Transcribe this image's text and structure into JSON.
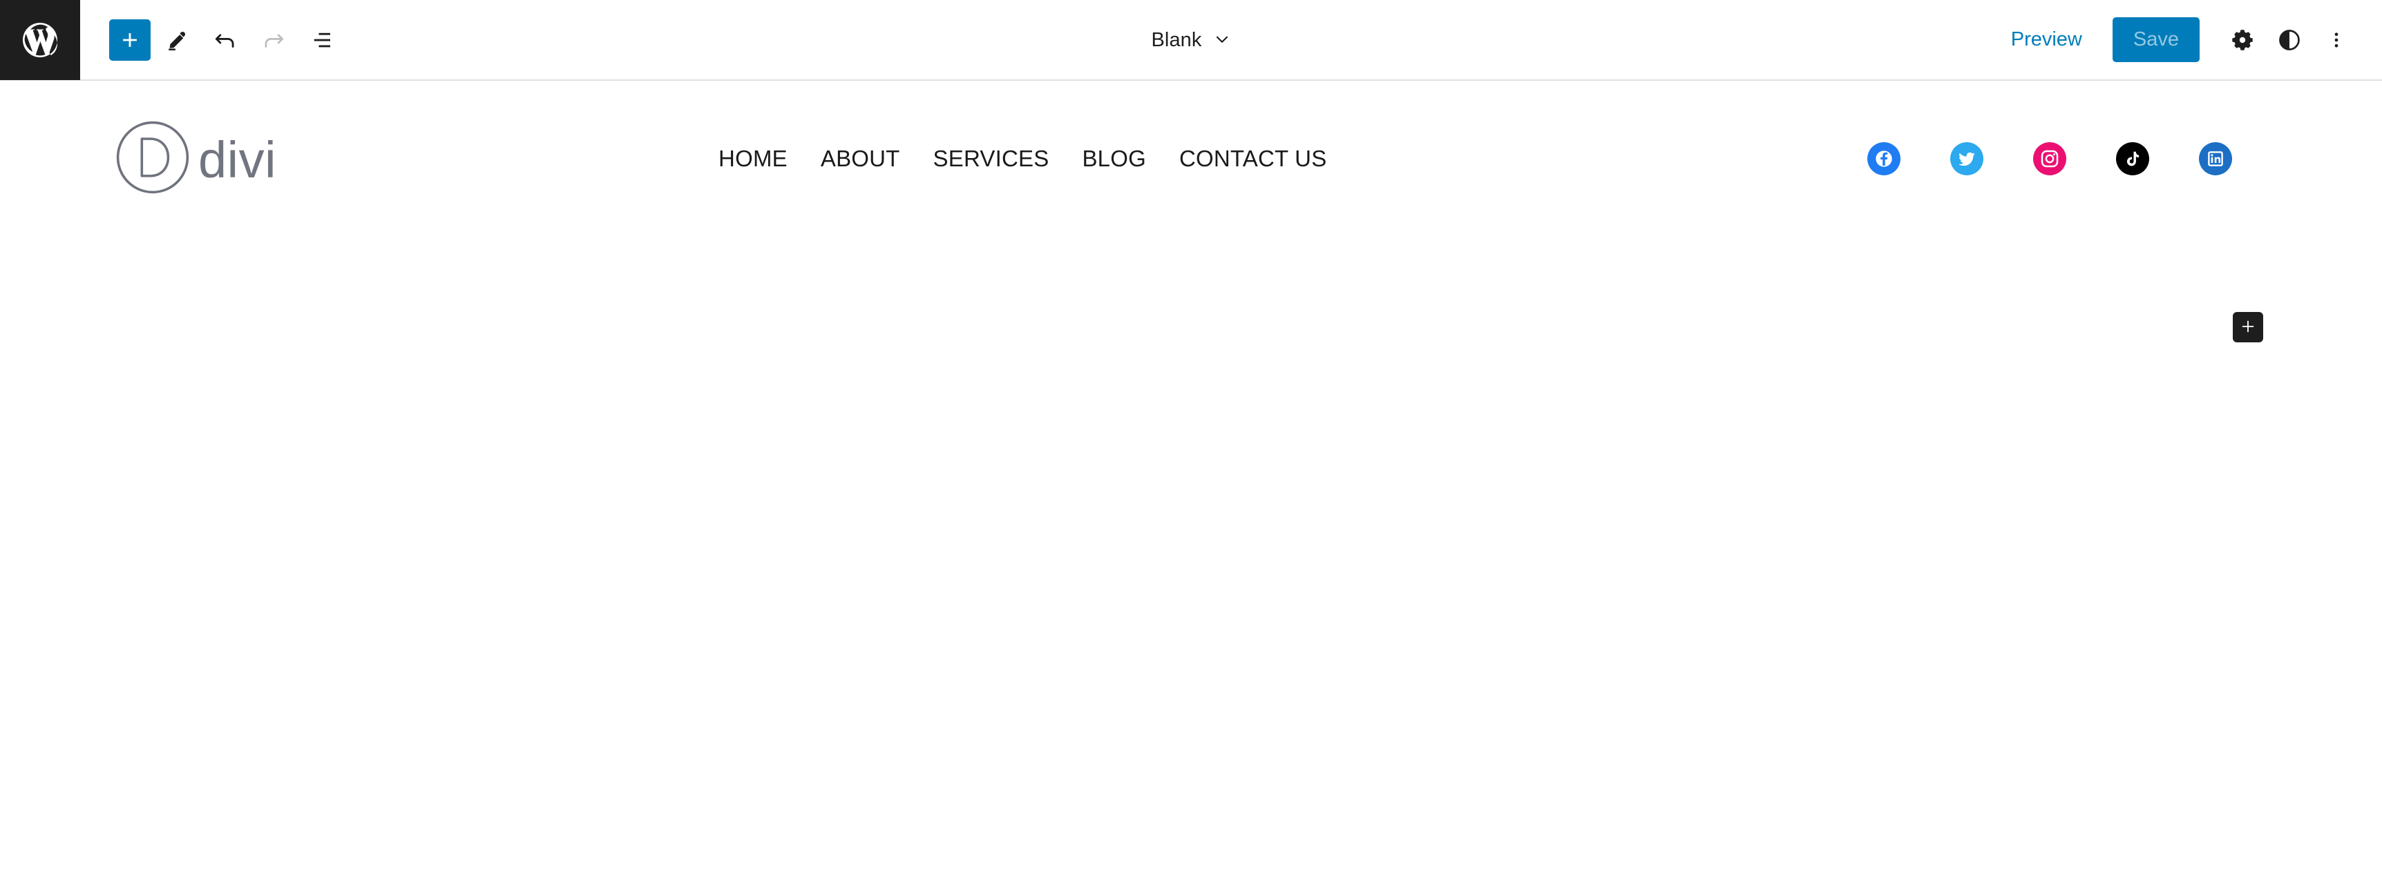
{
  "editor": {
    "wp_logo_label": "WordPress",
    "tools": [
      {
        "name": "block-inserter",
        "label": "Toggle block inserter",
        "icon": "plus-icon"
      },
      {
        "name": "tools-edit",
        "label": "Tools",
        "icon": "pencil-icon"
      },
      {
        "name": "undo",
        "label": "Undo",
        "icon": "undo-icon"
      },
      {
        "name": "redo",
        "label": "Redo",
        "icon": "redo-icon"
      },
      {
        "name": "document-overview",
        "label": "Document Overview",
        "icon": "list-view-icon"
      }
    ],
    "document_title": "Blank",
    "document_title_chevron": "chevron-down-icon",
    "preview_label": "Preview",
    "save_label": "Save",
    "right_tools": [
      {
        "name": "settings",
        "label": "Settings",
        "icon": "gear-icon"
      },
      {
        "name": "styles",
        "label": "Styles",
        "icon": "contrast-circle-icon"
      },
      {
        "name": "options",
        "label": "Options",
        "icon": "kebab-menu-icon"
      }
    ],
    "accent_color": "#007cba",
    "dark_color": "#1e1e1e"
  },
  "site": {
    "brand": {
      "mark_letter": "D",
      "word": "divi",
      "color": "#71757f"
    },
    "nav": [
      {
        "label": "HOME"
      },
      {
        "label": "ABOUT"
      },
      {
        "label": "SERVICES"
      },
      {
        "label": "BLOG"
      },
      {
        "label": "CONTACT US"
      }
    ],
    "social": [
      {
        "name": "facebook",
        "label": "Facebook",
        "color": "#1f7cf2"
      },
      {
        "name": "twitter",
        "label": "Twitter",
        "color": "#2ca9ef"
      },
      {
        "name": "instagram",
        "label": "Instagram",
        "color": "#ec0f72"
      },
      {
        "name": "tiktok",
        "label": "TikTok",
        "color": "#000000"
      },
      {
        "name": "linkedin",
        "label": "LinkedIn",
        "color": "#1c6fc4"
      }
    ],
    "appender": {
      "label": "Add block",
      "icon": "plus-icon"
    }
  }
}
